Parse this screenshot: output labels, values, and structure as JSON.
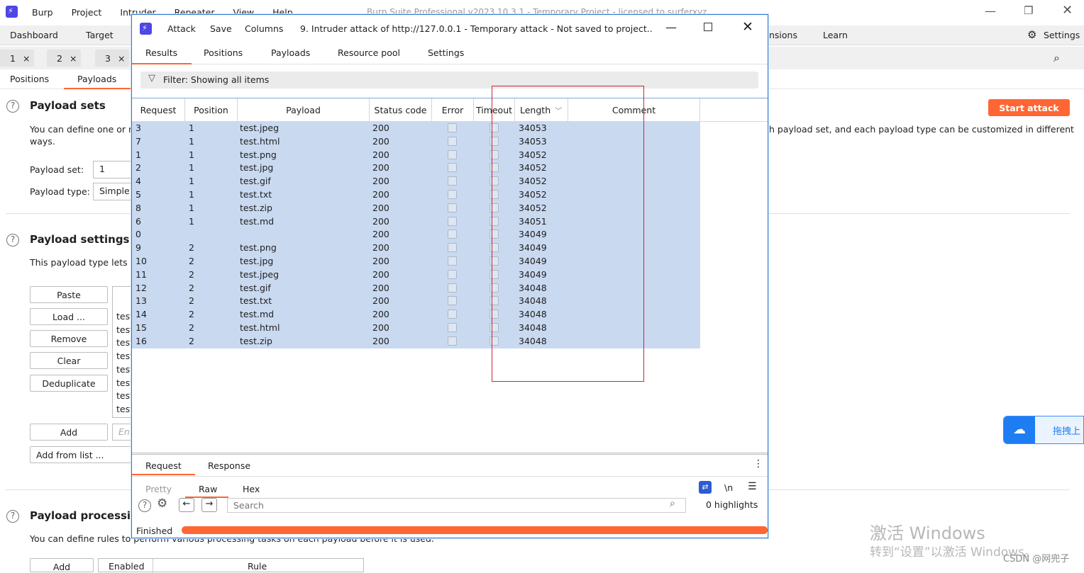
{
  "app": {
    "menu": [
      "Burp",
      "Project",
      "Intruder",
      "Repeater",
      "View",
      "Help"
    ],
    "title": "Burp Suite Professional v2023.10.3.1 - Temporary Project - licensed to surferxyz"
  },
  "main_tabs": {
    "dashboard": "Dashboard",
    "target": "Target",
    "extensions_partial": "nsions",
    "learn": "Learn",
    "settings": "Settings"
  },
  "attack_tabs": [
    {
      "label": "1"
    },
    {
      "label": "2"
    },
    {
      "label": "3"
    }
  ],
  "section_tabs": {
    "positions": "Positions",
    "payloads": "Payloads"
  },
  "payload_sets": {
    "title": "Payload sets",
    "desc_left": "You can define one or m",
    "desc_left2": "ways.",
    "desc_right": "h payload set, and each payload type can be customized in different",
    "set_label": "Payload set:",
    "set_value": "1",
    "type_label": "Payload type:",
    "type_value": "Simple"
  },
  "start_attack": "Start attack",
  "payload_settings": {
    "title": "Payload settings [S",
    "desc": "This payload type lets y",
    "buttons": [
      "Paste",
      "Load ...",
      "Remove",
      "Clear",
      "Deduplicate"
    ],
    "list_items": [
      "test",
      "test",
      "test",
      "test",
      "test",
      "test",
      "test",
      "test"
    ],
    "add": "Add",
    "add_placeholder": "Ent",
    "add_from_list": "Add from list ..."
  },
  "payload_processing": {
    "title": "Payload processing",
    "desc": "You can define rules to perform various processing tasks on each payload before it is used.",
    "add": "Add",
    "col1": "Enabled",
    "col2": "Rule"
  },
  "dialog": {
    "menu": [
      "Attack",
      "Save",
      "Columns"
    ],
    "title": "9. Intruder attack of http://127.0.0.1 - Temporary attack - Not saved to project..",
    "tabs": [
      "Results",
      "Positions",
      "Payloads",
      "Resource pool",
      "Settings"
    ],
    "filter": "Filter: Showing all items",
    "columns": [
      "Request",
      "Position",
      "Payload",
      "Status code",
      "Error",
      "Timeout",
      "Length",
      "Comment"
    ],
    "rows": [
      {
        "request": "3",
        "position": "1",
        "payload": "test.jpeg",
        "status": "200",
        "length": "34053"
      },
      {
        "request": "7",
        "position": "1",
        "payload": "test.html",
        "status": "200",
        "length": "34053"
      },
      {
        "request": "1",
        "position": "1",
        "payload": "test.png",
        "status": "200",
        "length": "34052"
      },
      {
        "request": "2",
        "position": "1",
        "payload": "test.jpg",
        "status": "200",
        "length": "34052"
      },
      {
        "request": "4",
        "position": "1",
        "payload": "test.gif",
        "status": "200",
        "length": "34052"
      },
      {
        "request": "5",
        "position": "1",
        "payload": "test.txt",
        "status": "200",
        "length": "34052"
      },
      {
        "request": "8",
        "position": "1",
        "payload": "test.zip",
        "status": "200",
        "length": "34052"
      },
      {
        "request": "6",
        "position": "1",
        "payload": "test.md",
        "status": "200",
        "length": "34051"
      },
      {
        "request": "0",
        "position": "",
        "payload": "",
        "status": "200",
        "length": "34049"
      },
      {
        "request": "9",
        "position": "2",
        "payload": "test.png",
        "status": "200",
        "length": "34049"
      },
      {
        "request": "10",
        "position": "2",
        "payload": "test.jpg",
        "status": "200",
        "length": "34049"
      },
      {
        "request": "11",
        "position": "2",
        "payload": "test.jpeg",
        "status": "200",
        "length": "34049"
      },
      {
        "request": "12",
        "position": "2",
        "payload": "test.gif",
        "status": "200",
        "length": "34048"
      },
      {
        "request": "13",
        "position": "2",
        "payload": "test.txt",
        "status": "200",
        "length": "34048"
      },
      {
        "request": "14",
        "position": "2",
        "payload": "test.md",
        "status": "200",
        "length": "34048"
      },
      {
        "request": "15",
        "position": "2",
        "payload": "test.html",
        "status": "200",
        "length": "34048"
      },
      {
        "request": "16",
        "position": "2",
        "payload": "test.zip",
        "status": "200",
        "length": "34048"
      }
    ],
    "bottom_tabs": [
      "Request",
      "Response"
    ],
    "view_tabs": [
      "Pretty",
      "Raw",
      "Hex"
    ],
    "newline_toggle": "\\n",
    "search_placeholder": "Search",
    "highlights": "0 highlights",
    "status": "Finished",
    "progress": 1.0
  },
  "baidu_widget": "拖拽上",
  "watermark": {
    "line1": "激活 Windows",
    "line2": "转到“设置”以激活 Windows。",
    "csdn": "CSDN @网兜子"
  },
  "colors": {
    "accent": "#ff6633",
    "selection": "#c9d9f0",
    "brand": "#4f46e5",
    "red_box": "#d0262c"
  }
}
